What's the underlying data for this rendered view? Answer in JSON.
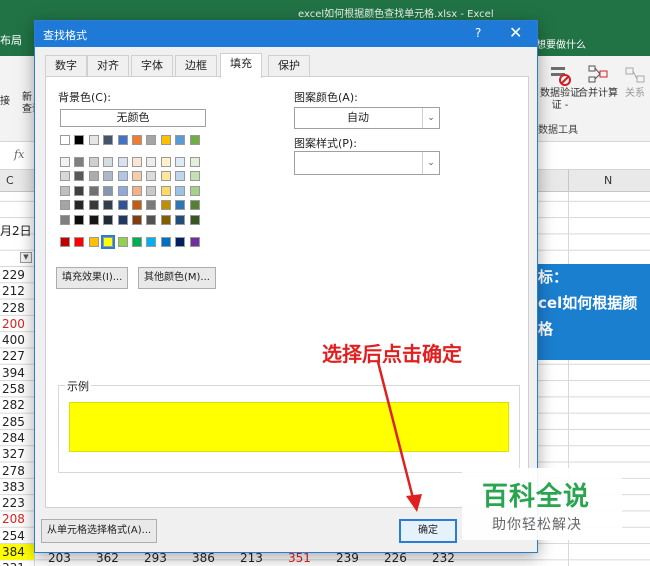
{
  "excel": {
    "window_title": "excel如何根据颜色查找单元格.xlsx  -  Excel",
    "ribbon_tab_left": "布局",
    "tell_me": "想要做什么",
    "ribbon_buttons": [
      "数据验证",
      "合并计算",
      "关系"
    ],
    "data_validation_sub": "证 -",
    "group_label": "数据工具",
    "cut_left_1": "接",
    "cut_left_2": "新\n查询",
    "fx": "fx",
    "col_c": "C",
    "col_n": "N",
    "date_cell": "月2日",
    "filter_glyph": "▼",
    "column_values": [
      "229",
      "212",
      "228",
      "200",
      "400",
      "227",
      "394",
      "258",
      "282",
      "285",
      "284",
      "327",
      "278",
      "383",
      "223",
      "208",
      "254",
      "384",
      "331"
    ],
    "red_rows": [
      3,
      15
    ],
    "highlight_rows": [
      17
    ],
    "bottom_row": [
      "203",
      "362",
      "293",
      "386",
      "213",
      "351",
      "239",
      "226",
      "232"
    ],
    "bottom_red_index": 5,
    "banner_lines": [
      "标：",
      "cel如何根据颜",
      "格"
    ]
  },
  "dialog": {
    "title": "查找格式",
    "help": "?",
    "close": "✕",
    "tabs": [
      "数字",
      "对齐",
      "字体",
      "边框",
      "填充",
      "保护"
    ],
    "active_tab": 4,
    "background_color_label": "背景色(C):",
    "no_color": "无颜色",
    "pattern_color_label": "图案颜色(A):",
    "pattern_color_value": "自动",
    "pattern_style_label": "图案样式(P):",
    "pattern_style_value": "",
    "fill_effects": "填充效果(I)...",
    "more_colors": "其他颜色(M)...",
    "sample_label": "示例",
    "sample_color": "#FFFF00",
    "from_cell": "从单元格选择格式(A)...",
    "ok": "确定"
  },
  "palette": {
    "theme_top": [
      "#FFFFFF",
      "#000000",
      "#E7E6E6",
      "#44546A",
      "#4472C4",
      "#ED7D31",
      "#A5A5A5",
      "#FFC000",
      "#5B9BD5",
      "#70AD47"
    ],
    "theme_tints": [
      [
        "#F2F2F2",
        "#7F7F7F",
        "#D0CECE",
        "#D6DCE4",
        "#D9E2F3",
        "#FBE5D5",
        "#EDEDED",
        "#FFF2CC",
        "#DEEBF6",
        "#E2EFD9"
      ],
      [
        "#D8D8D8",
        "#595959",
        "#AEABAB",
        "#ADB9CA",
        "#B4C6E7",
        "#F7CBAC",
        "#DBDBDB",
        "#FEE599",
        "#BDD7EE",
        "#C5E0B3"
      ],
      [
        "#BFBFBF",
        "#3F3F3F",
        "#757070",
        "#8496B0",
        "#8EAADB",
        "#F4B183",
        "#C9C9C9",
        "#FFD965",
        "#9CC3E5",
        "#A8D08D"
      ],
      [
        "#A5A5A5",
        "#262626",
        "#3A3838",
        "#323F4F",
        "#2F5496",
        "#C55A11",
        "#7B7B7B",
        "#BF8F00",
        "#2E75B5",
        "#538135"
      ],
      [
        "#7F7F7F",
        "#0C0C0C",
        "#171616",
        "#222A35",
        "#1F3864",
        "#833C0B",
        "#525252",
        "#7F6000",
        "#1E4E79",
        "#375623"
      ]
    ],
    "standard": [
      "#C00000",
      "#FF0000",
      "#FFC000",
      "#FFFF00",
      "#92D050",
      "#00B050",
      "#00B0F0",
      "#0070C0",
      "#002060",
      "#7030A0"
    ],
    "selected_standard_index": 3
  },
  "annotation": {
    "text": "选择后点击确定"
  },
  "watermark": {
    "big": "百科全说",
    "small": "助你轻松解决"
  }
}
